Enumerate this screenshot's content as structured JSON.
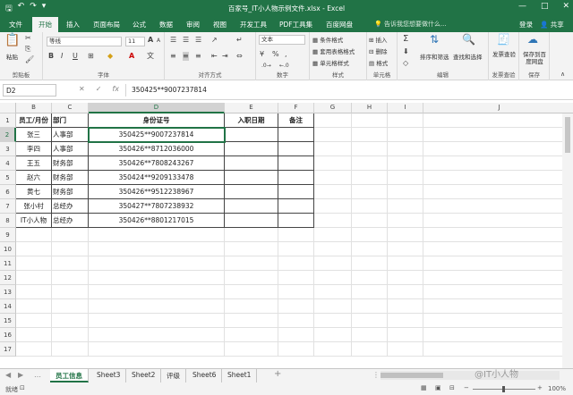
{
  "window": {
    "title": "百家号_IT小人物示例文件.xlsx - Excel",
    "controls": [
      "—",
      "□",
      "✕"
    ]
  },
  "qat": {
    "save_icon": "save-icon",
    "undo_icon": "undo-icon",
    "redo_icon": "redo-icon",
    "customize_icon": "customize-icon"
  },
  "tabs": [
    "文件",
    "开始",
    "插入",
    "页面布局",
    "公式",
    "数据",
    "审阅",
    "视图",
    "开发工具",
    "PDF工具集",
    "百度网盘"
  ],
  "active_tab": "开始",
  "tell_me": "告诉我您想要做什么...",
  "login": "登录",
  "share": "共享",
  "ribbon": {
    "clipboard": {
      "label": "剪贴板",
      "paste": "粘贴"
    },
    "font": {
      "label": "字体",
      "name": "等线",
      "size": "11",
      "bold": "B",
      "italic": "I",
      "underline": "U",
      "grow": "A",
      "shrink": "A"
    },
    "alignment": {
      "label": "对齐方式"
    },
    "number": {
      "label": "数字",
      "format": "文本",
      "percent": "%",
      "comma": ","
    },
    "styles": {
      "label": "样式",
      "cond": "条件格式",
      "table": "套用表格格式",
      "cell": "单元格样式"
    },
    "cells": {
      "label": "单元格",
      "insert": "插入",
      "delete": "删除",
      "format": "格式"
    },
    "editing": {
      "label": "编辑",
      "sort": "排序和筛选",
      "find": "查找和选择"
    },
    "invoice": {
      "label": "发票查验",
      "btn": "发票查验"
    },
    "save": {
      "label": "保存",
      "btn": "保存到百度网盘"
    }
  },
  "formula": {
    "namebox": "D2",
    "value": "350425**9007237814",
    "cancel": "✕",
    "enter": "✓",
    "fx": "fx"
  },
  "columns": [
    "B",
    "C",
    "D",
    "E",
    "F",
    "G",
    "H",
    "I",
    "J"
  ],
  "selected_col": "D",
  "rows": [
    "1",
    "2",
    "3",
    "4",
    "5",
    "6",
    "7",
    "8",
    "9",
    "10",
    "11",
    "12",
    "13",
    "14",
    "15",
    "16",
    "17"
  ],
  "selected_row": "2",
  "table": {
    "headers": [
      "员工/月份",
      "部门",
      "身份证号",
      "入职日期",
      "备注"
    ],
    "data": [
      [
        "张三",
        "人事部",
        "350425**9007237814",
        "",
        ""
      ],
      [
        "李四",
        "人事部",
        "350426**8712036000",
        "",
        ""
      ],
      [
        "王五",
        "财务部",
        "350426**7808243267",
        "",
        ""
      ],
      [
        "赵六",
        "财务部",
        "350424**9209133478",
        "",
        ""
      ],
      [
        "黄七",
        "财务部",
        "350426**9512238967",
        "",
        ""
      ],
      [
        "张小村",
        "总经办",
        "350427**7807238932",
        "",
        ""
      ],
      [
        "IT小人物",
        "总经办",
        "350426**8801217015",
        "",
        ""
      ]
    ]
  },
  "sheets": [
    "员工信息",
    "Sheet3",
    "Sheet2",
    "评级",
    "Sheet6",
    "Sheet1"
  ],
  "active_sheet": "员工信息",
  "add_sheet": "+",
  "status": {
    "ready": "就绪",
    "zoom": "100%"
  },
  "watermark": "@IT小人物"
}
